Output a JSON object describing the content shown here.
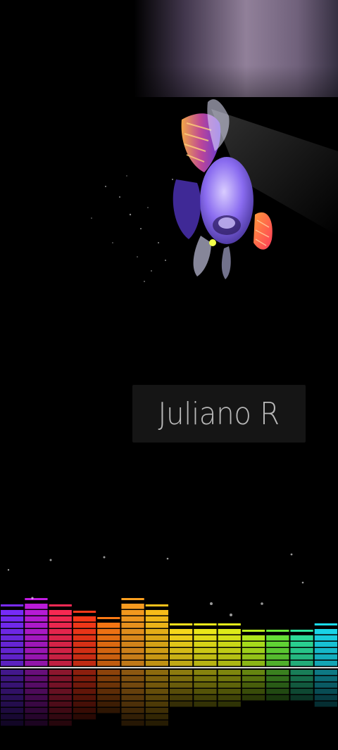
{
  "wallpaper": {
    "name_label": "Juliano R"
  },
  "icons": {
    "fish_artwork": "betta-fish-icon",
    "visualizer": "audio-equalizer-icon"
  },
  "colors": {
    "background": "#000000",
    "name_text": "#b8b8b8",
    "name_card": "#262626",
    "fish_body": "#8a6cf0",
    "fish_fins": "#ff6a2e"
  },
  "equalizer": {
    "bar_levels": [
      0.28,
      0.29,
      0.28,
      0.24,
      0.22,
      0.31,
      0.27,
      0.18,
      0.18,
      0.18,
      0.15,
      0.14,
      0.14,
      0.18
    ],
    "bar_colors": [
      "#7a2cff",
      "#c01ce0",
      "#ff2a55",
      "#ff3a1a",
      "#ff7a14",
      "#ffa020",
      "#ffc21a",
      "#ffe01c",
      "#f4ef1a",
      "#e6f41a",
      "#b8f21e",
      "#6aea3a",
      "#2ee6a0",
      "#1adcf0"
    ]
  }
}
